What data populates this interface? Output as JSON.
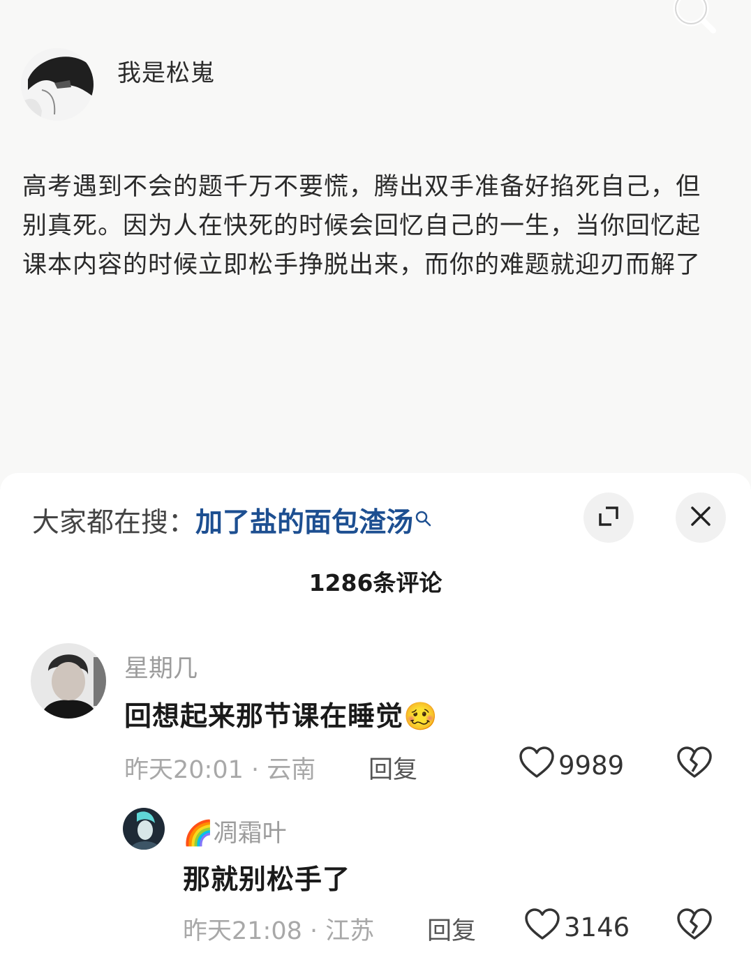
{
  "post": {
    "author": "我是松嵬",
    "text": "高考遇到不会的题千万不要慌，腾出双手准备好掐死自己，但别真死。因为人在快死的时候会回忆自己的一生，当你回忆起课本内容的时候立即松手挣脱出来，而你的难题就迎刃而解了"
  },
  "sheet": {
    "hot_label": "大家都在搜：",
    "hot_query": "加了盐的面包渣汤",
    "comment_count": "1286条评论"
  },
  "comments": [
    {
      "user": "星期几",
      "text": "回想起来那节课在睡觉",
      "emoji": "🥴",
      "time": "昨天20:01 · 云南",
      "reply": "回复",
      "likes": "9989"
    },
    {
      "user_prefix": "🌈",
      "user": "凋霜叶",
      "text": "那就别松手了",
      "time": "昨天21:08 · 江苏",
      "reply": "回复",
      "likes": "3146"
    }
  ],
  "icons": {
    "search": "search-icon",
    "expand": "expand-icon",
    "close": "close-icon",
    "like": "heart-icon",
    "dislike": "broken-heart-icon"
  },
  "colors": {
    "accent": "#1d4f91",
    "muted": "#a8a8a8"
  }
}
